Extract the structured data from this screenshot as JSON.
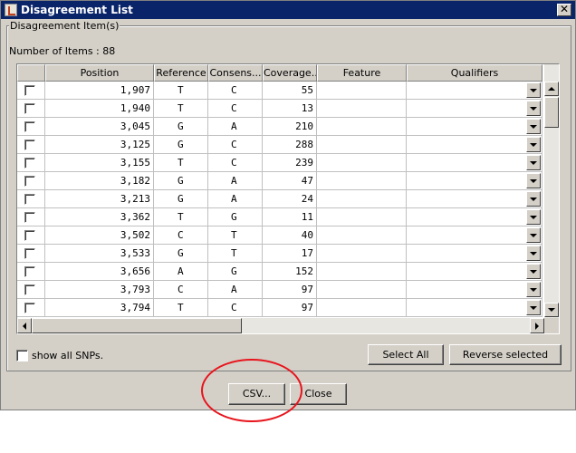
{
  "window": {
    "title": "Disagreement List"
  },
  "group": {
    "legend": "Disagreement Item(s)",
    "count_label": "Number of Items : 88"
  },
  "table": {
    "columns": [
      "",
      "Position",
      "Reference",
      "Consens...",
      "Coverage...",
      "Feature",
      "Qualifiers"
    ],
    "rows": [
      [
        "1,907",
        "T",
        "C",
        "55"
      ],
      [
        "1,940",
        "T",
        "C",
        "13"
      ],
      [
        "3,045",
        "G",
        "A",
        "210"
      ],
      [
        "3,125",
        "G",
        "C",
        "288"
      ],
      [
        "3,155",
        "T",
        "C",
        "239"
      ],
      [
        "3,182",
        "G",
        "A",
        "47"
      ],
      [
        "3,213",
        "G",
        "A",
        "24"
      ],
      [
        "3,362",
        "T",
        "G",
        "11"
      ],
      [
        "3,502",
        "C",
        "T",
        "40"
      ],
      [
        "3,533",
        "G",
        "T",
        "17"
      ],
      [
        "3,656",
        "A",
        "G",
        "152"
      ],
      [
        "3,793",
        "C",
        "A",
        "97"
      ],
      [
        "3,794",
        "T",
        "C",
        "97"
      ]
    ]
  },
  "controls": {
    "show_all_snps": "show all SNPs.",
    "select_all": "Select All",
    "reverse_selected": "Reverse selected",
    "csv": "CSV...",
    "close": "Close"
  },
  "icons": {
    "close": "close-icon",
    "app": "app-icon",
    "dropdown": "chevron-down-icon"
  },
  "colors": {
    "title_bar": "#0a246a",
    "window_bg": "#d4d0c8",
    "highlight": "#e8141c"
  }
}
